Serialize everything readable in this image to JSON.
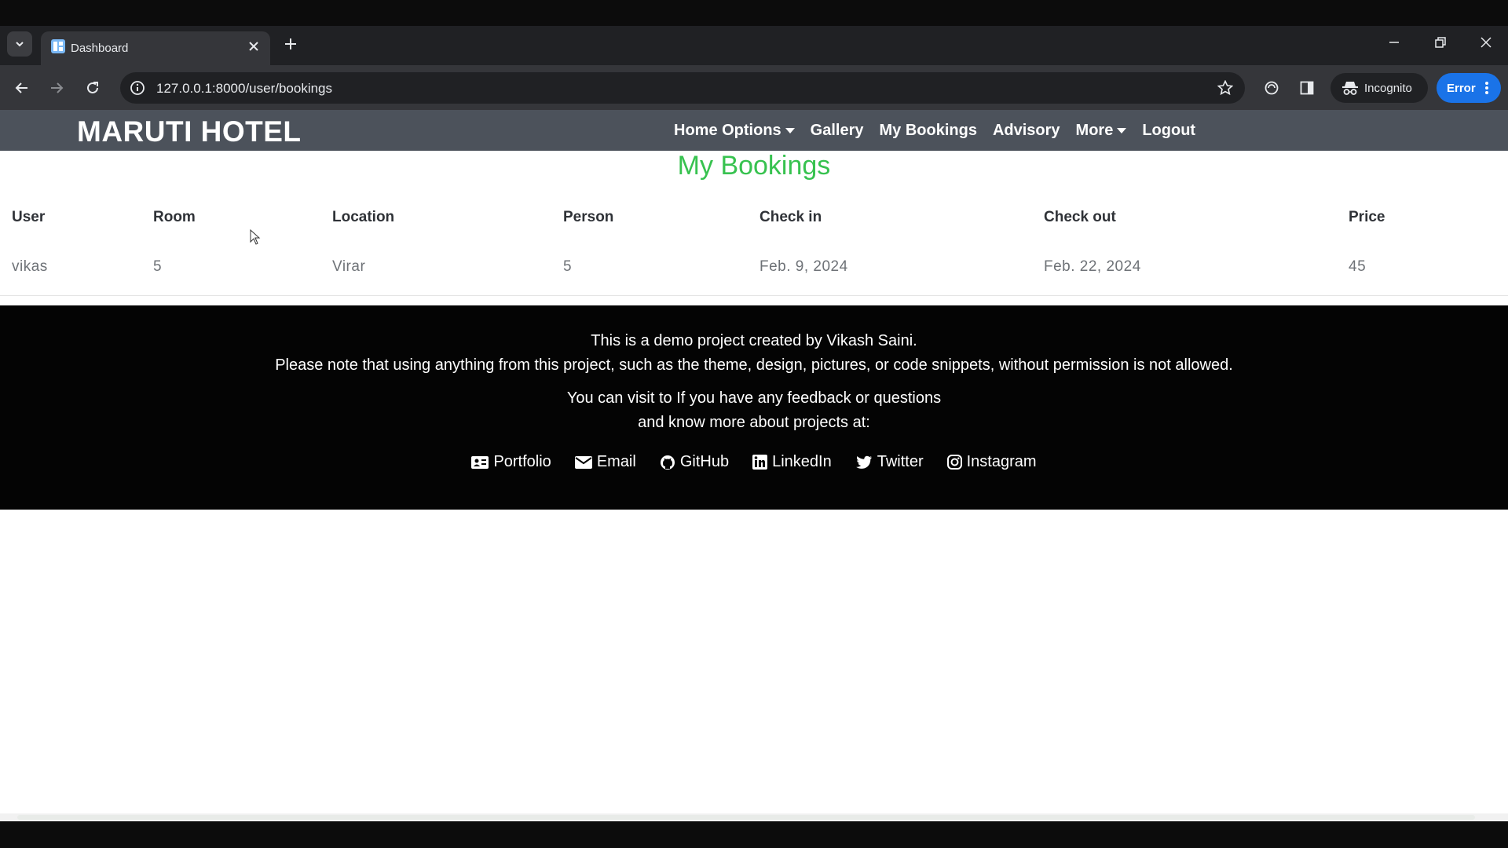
{
  "browser": {
    "tab_title": "Dashboard",
    "url": "127.0.0.1:8000/user/bookings",
    "incognito_label": "Incognito",
    "error_label": "Error"
  },
  "navbar": {
    "brand": "MARUTI HOTEL",
    "links": [
      {
        "label": "Home Options",
        "dropdown": true
      },
      {
        "label": "Gallery",
        "dropdown": false
      },
      {
        "label": "My Bookings",
        "dropdown": false
      },
      {
        "label": "Advisory",
        "dropdown": false
      },
      {
        "label": "More",
        "dropdown": true
      },
      {
        "label": "Logout",
        "dropdown": false
      }
    ]
  },
  "page": {
    "title": "My Bookings",
    "title_color": "#37c24f"
  },
  "bookings": {
    "headers": [
      "User",
      "Room",
      "Location",
      "Person",
      "Check in",
      "Check out",
      "Price"
    ],
    "rows": [
      [
        "vikas",
        "5",
        "Virar",
        "5",
        "Feb. 9, 2024",
        "Feb. 22, 2024",
        "45"
      ]
    ]
  },
  "footer": {
    "line1": "This is a demo project created by Vikash Saini.",
    "line2": "Please note that using anything from this project, such as the theme, design, pictures, or code snippets, without permission is not allowed.",
    "line3": "You can visit to If you have any feedback or questions",
    "line4": "and know more about projects at:",
    "links": [
      {
        "label": "Portfolio",
        "icon": "id-card-icon"
      },
      {
        "label": "Email",
        "icon": "envelope-icon"
      },
      {
        "label": "GitHub",
        "icon": "github-icon"
      },
      {
        "label": "LinkedIn",
        "icon": "linkedin-icon"
      },
      {
        "label": "Twitter",
        "icon": "twitter-icon"
      },
      {
        "label": "Instagram",
        "icon": "instagram-icon"
      }
    ]
  }
}
